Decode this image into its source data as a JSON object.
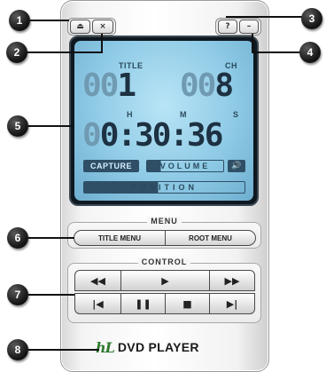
{
  "callouts": [
    "1",
    "2",
    "3",
    "4",
    "5",
    "6",
    "7",
    "8"
  ],
  "titlebar": {
    "eject_icon": "⏏",
    "close_icon": "×",
    "help_icon": "?",
    "minimize_icon": "–"
  },
  "lcd": {
    "title_label": "TITLE",
    "chapter_label": "CH",
    "hours_label": "H",
    "minutes_label": "M",
    "seconds_label": "S",
    "title_dim": "00",
    "title_lit": "1",
    "chapter_dim": "00",
    "chapter_lit": "8",
    "time_dim": "0",
    "time_lit": "0:30:36",
    "capture_label": "CAPTURE",
    "volume_label": "VOLUME",
    "volume_level_fraction": 0.18,
    "speaker_icon": "🔊",
    "position_label": "POSITION",
    "position_fraction": 0.46
  },
  "menu": {
    "group_label": "MENU",
    "title_menu": "TITLE MENU",
    "root_menu": "ROOT MENU"
  },
  "control": {
    "group_label": "CONTROL",
    "rewind_icon": "◀◀",
    "play_icon": "▶",
    "forward_icon": "▶▶",
    "prev_icon": "|◀",
    "pause_icon": "❚❚",
    "stop_icon": "■",
    "next_icon": "▶|"
  },
  "brand": {
    "logo": "hL",
    "name": "DVD PLAYER"
  },
  "colors": {
    "lcd_background": "#8fcbe6",
    "lcd_text": "#1d3142",
    "lcd_dim_text": "#6f9ab2",
    "logo_green": "#2f7a2f"
  }
}
